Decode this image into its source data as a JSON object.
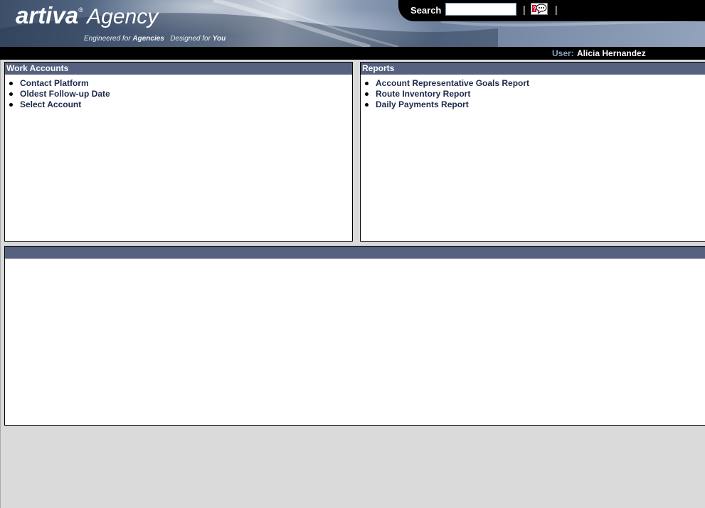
{
  "header": {
    "logo_brand": "artiva",
    "logo_reg": "®",
    "logo_product": "Agency",
    "tagline_engineered": "Engineered for ",
    "tagline_agencies": "Agencies",
    "tagline_designed": "Designed for ",
    "tagline_you": "You",
    "search_label": "Search",
    "search_value": "",
    "separator": "|",
    "help_icon": "help-chat-icon"
  },
  "userbar": {
    "user_label": "User:",
    "user_name": "Alicia Hernandez"
  },
  "work_accounts": {
    "title": "Work Accounts",
    "items": [
      "Contact Platform",
      "Oldest Follow-up Date",
      "Select Account"
    ]
  },
  "reports": {
    "title": "Reports",
    "items": [
      "Account Representative Goals Report",
      "Route Inventory Report",
      "Daily Payments Report"
    ]
  },
  "bottom_panel": {
    "title": ""
  },
  "colors": {
    "panel_header": "#56607f",
    "background": "#dadada",
    "link_text": "#1b2a4a",
    "user_label": "#8ca0c4"
  }
}
